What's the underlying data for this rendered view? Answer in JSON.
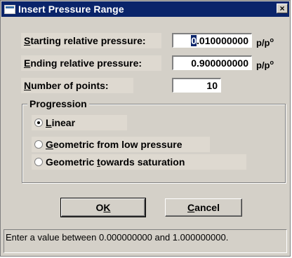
{
  "window": {
    "title": "Insert Pressure Range",
    "close_label": "×"
  },
  "fields": {
    "start": {
      "label_key": "S",
      "label_rest": "tarting relative pressure:",
      "value_first": "0",
      "value_rest": ".010000000",
      "unit_base": "p/p",
      "unit_sup": "o"
    },
    "end": {
      "label_key": "E",
      "label_rest": "nding relative pressure:",
      "value": "0.900000000",
      "unit_base": "p/p",
      "unit_sup": "o"
    },
    "points": {
      "label_key": "N",
      "label_rest": "umber of points:",
      "value": "10"
    }
  },
  "progression": {
    "legend": "Progression",
    "options": [
      {
        "pre": "",
        "key": "L",
        "post": "inear",
        "checked": true
      },
      {
        "pre": "",
        "key": "G",
        "post": "eometric from low pressure",
        "checked": false
      },
      {
        "pre": "Geometric ",
        "key": "t",
        "post": "owards saturation",
        "checked": false
      }
    ]
  },
  "buttons": {
    "ok_pre": "O",
    "ok_key": "K",
    "cancel_key": "C",
    "cancel_rest": "ancel"
  },
  "status": {
    "text": "Enter a value between 0.000000000 and 1.000000000."
  }
}
